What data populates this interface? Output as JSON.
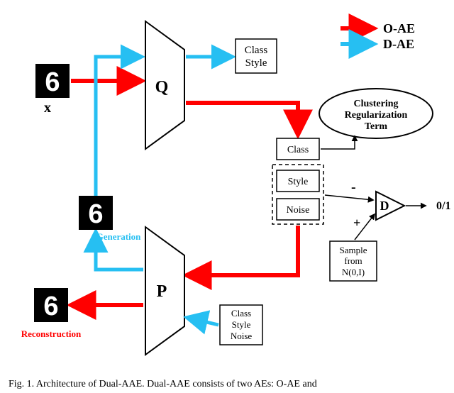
{
  "legend": {
    "o_ae": "O-AE",
    "d_ae": "D-AE"
  },
  "input_label": "x",
  "Q_label": "Q",
  "P_label": "P",
  "q_out_top": {
    "line1": "Class",
    "line2": "Style"
  },
  "latent": {
    "class": "Class",
    "style": "Style",
    "noise": "Noise"
  },
  "cluster_term": {
    "line1": "Clustering",
    "line2": "Regularization",
    "line3": "Term"
  },
  "discriminator": {
    "label": "D",
    "out": "0/1",
    "neg": "-",
    "pos": "+"
  },
  "sample_box": {
    "line1": "Sample",
    "line2": "from",
    "line3": "N(0,I)"
  },
  "p_in_bottom": {
    "line1": "Class",
    "line2": "Style",
    "line3": "Noise"
  },
  "gen_label": "Generation",
  "rec_label": "Reconstruction",
  "caption": "Fig. 1.   Architecture of Dual-AAE. Dual-AAE consists of two AEs: O-AE and"
}
